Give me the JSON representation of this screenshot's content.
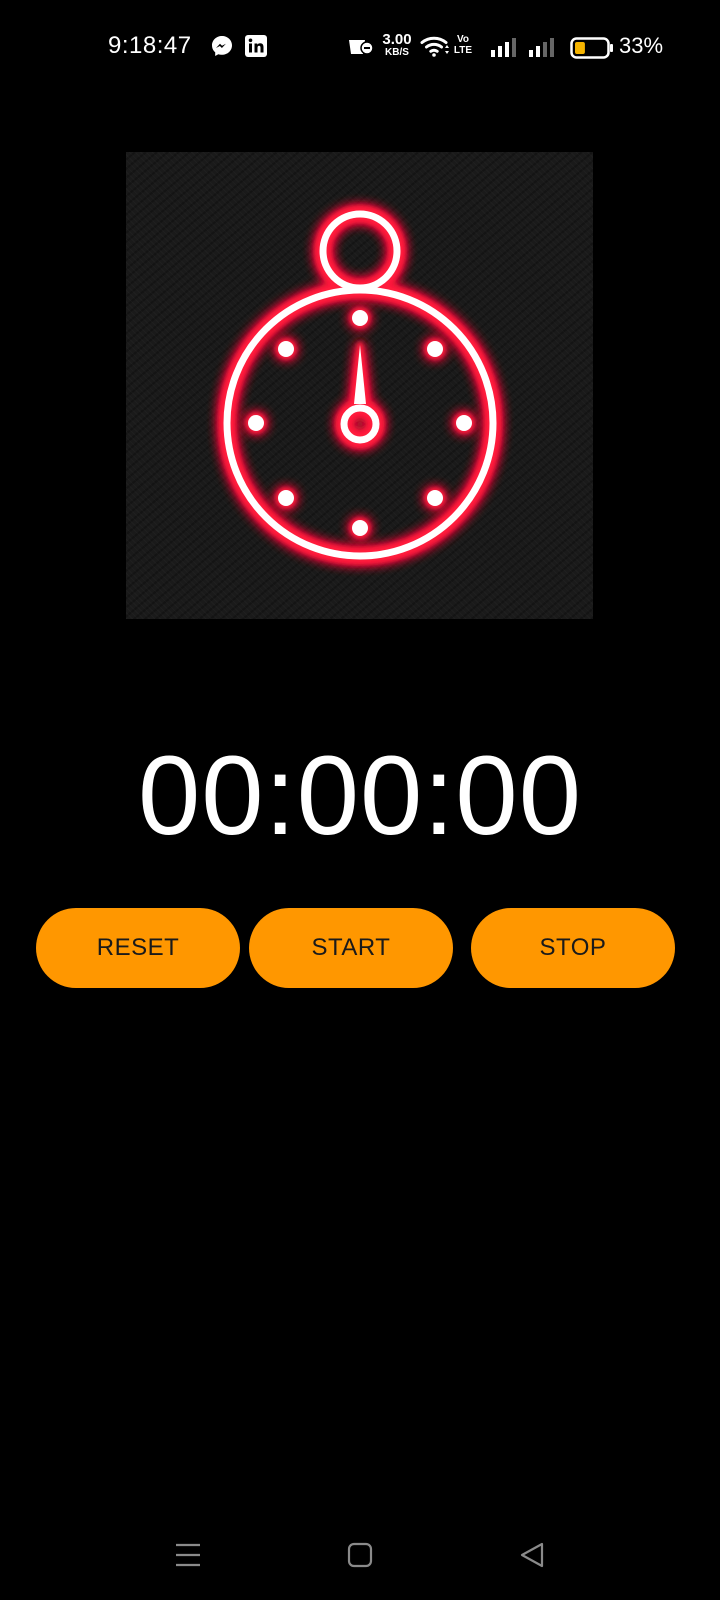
{
  "status_bar": {
    "time": "9:18:47",
    "net_speed_value": "3.00",
    "net_speed_unit": "KB/S",
    "volte_top": "Vo",
    "volte_bottom": "LTE",
    "battery_percent": "33%",
    "battery_level": 0.33,
    "battery_color": "#f5b400",
    "icons": [
      "messenger-icon",
      "linkedin-icon",
      "data-saver-icon",
      "wifi-icon",
      "signal-sim1-icon",
      "signal-sim2-icon",
      "battery-icon"
    ]
  },
  "hero": {
    "icon": "stopwatch-icon",
    "glow_color": "#ff1a3c"
  },
  "timer": {
    "display": "00:00:00"
  },
  "buttons": {
    "reset_label": "RESET",
    "start_label": "START",
    "stop_label": "STOP",
    "color": "#ff9700"
  },
  "nav_bar": {
    "icons": [
      "menu-icon",
      "home-icon",
      "back-icon"
    ]
  }
}
